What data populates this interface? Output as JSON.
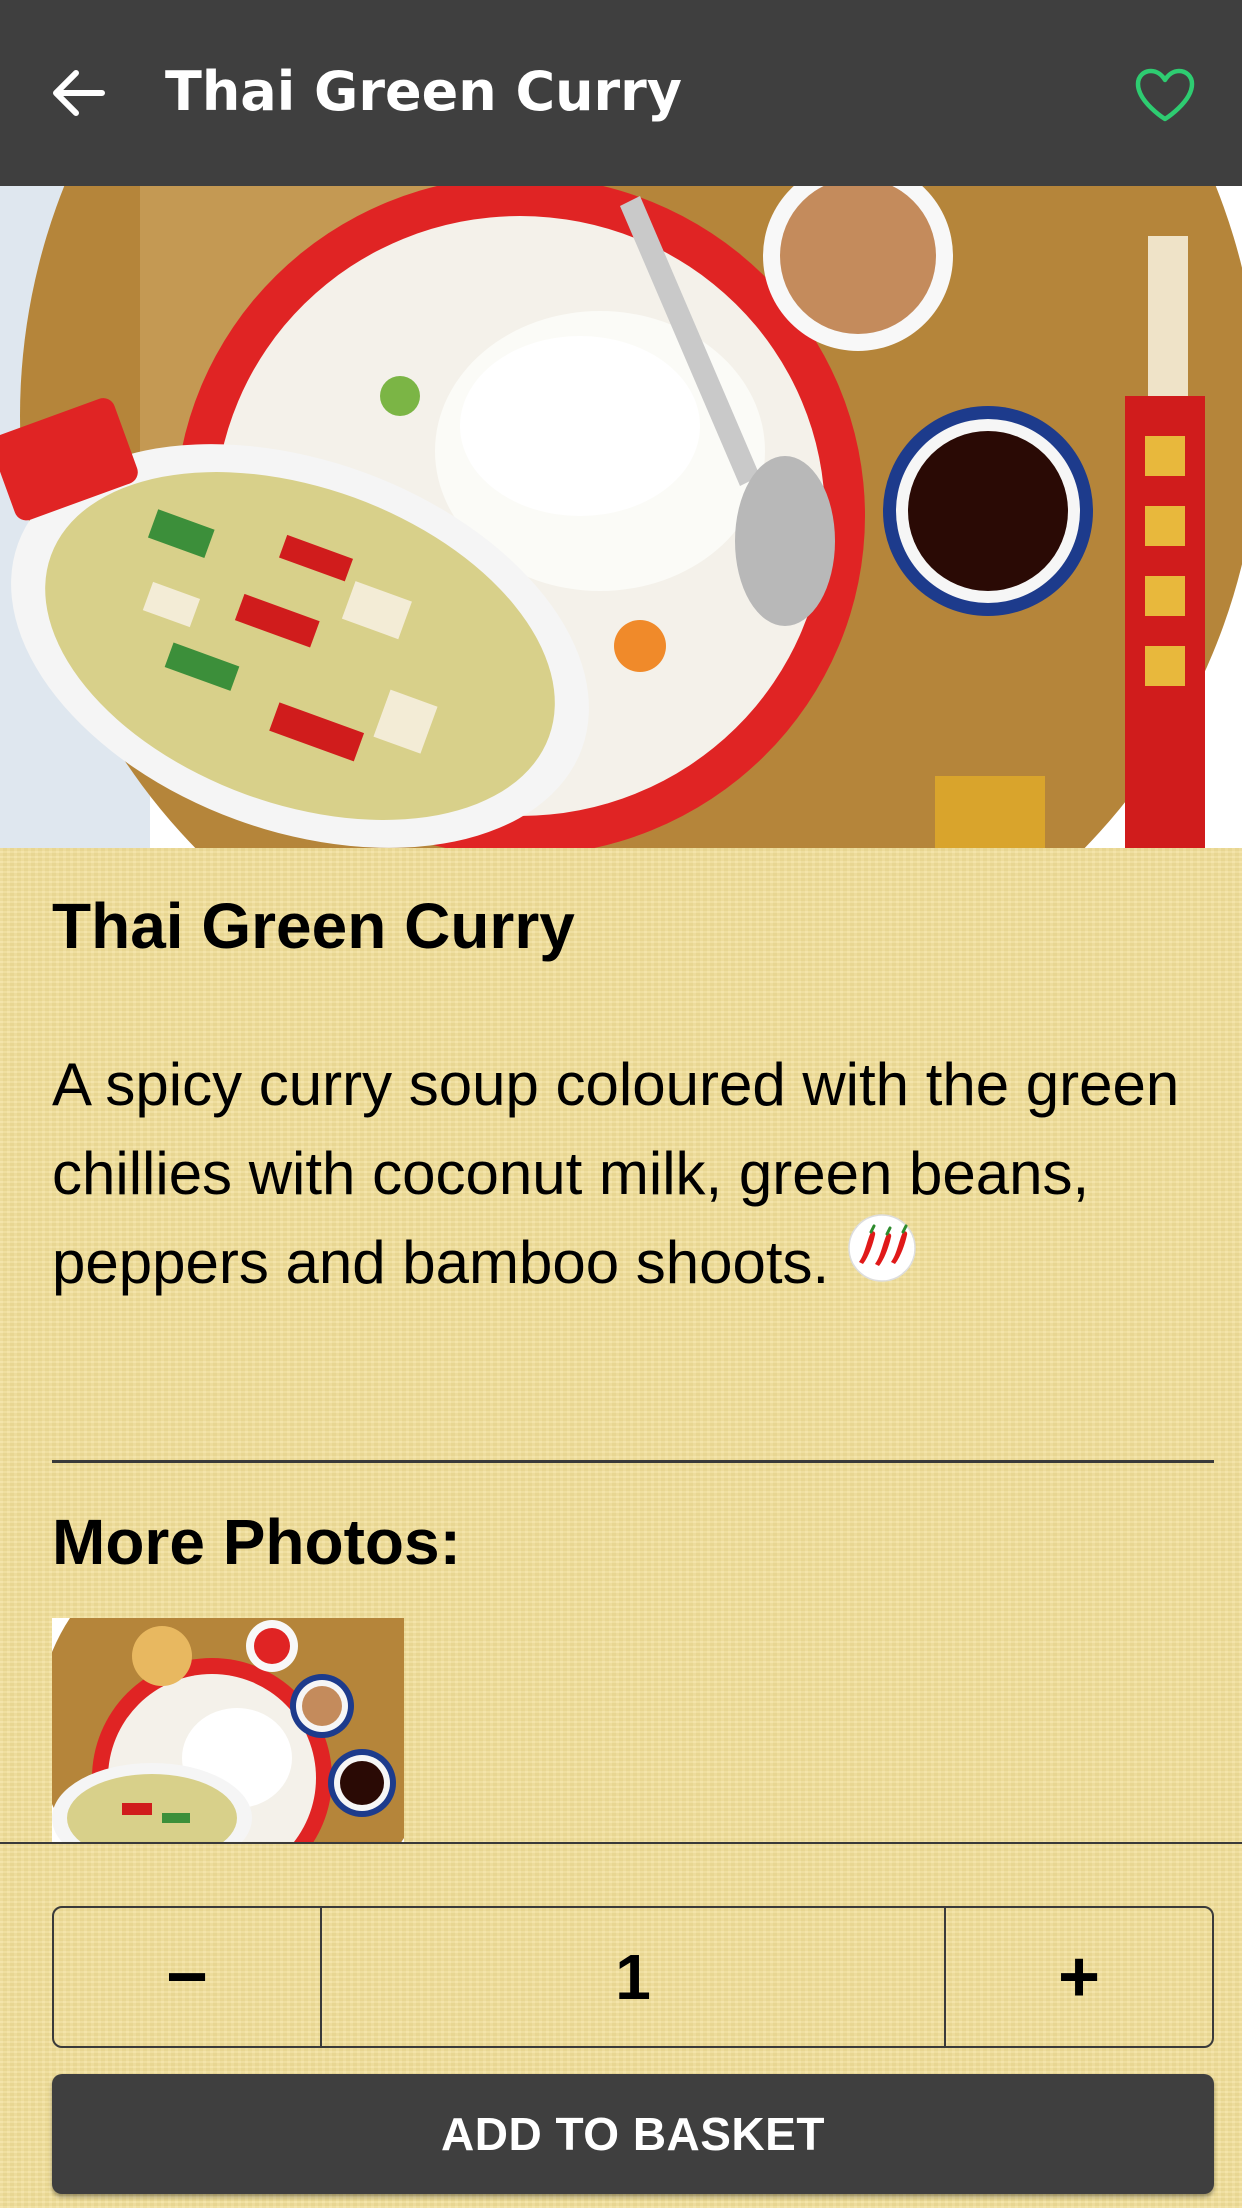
{
  "app_bar": {
    "title": "Thai Green Curry",
    "back_icon": "arrow-left-icon",
    "favorite_icon": "heart-outline-icon"
  },
  "dish": {
    "title": "Thai Green Curry",
    "description": "A spicy curry soup coloured with the green chillies with coconut milk, green beans, peppers and bamboo shoots.",
    "spice_icon": "chilli-peppers-icon"
  },
  "more_photos": {
    "label": "More Photos:"
  },
  "quantity": {
    "minus_label": "−",
    "value": "1",
    "plus_label": "+"
  },
  "add_to_basket": {
    "label": "ADD TO BASKET"
  },
  "colors": {
    "app_bar_bg": "#3f3f3f",
    "favorite_accent": "#2ecc71",
    "page_bg": "#f2df98",
    "button_bg": "#3f3f3f"
  }
}
